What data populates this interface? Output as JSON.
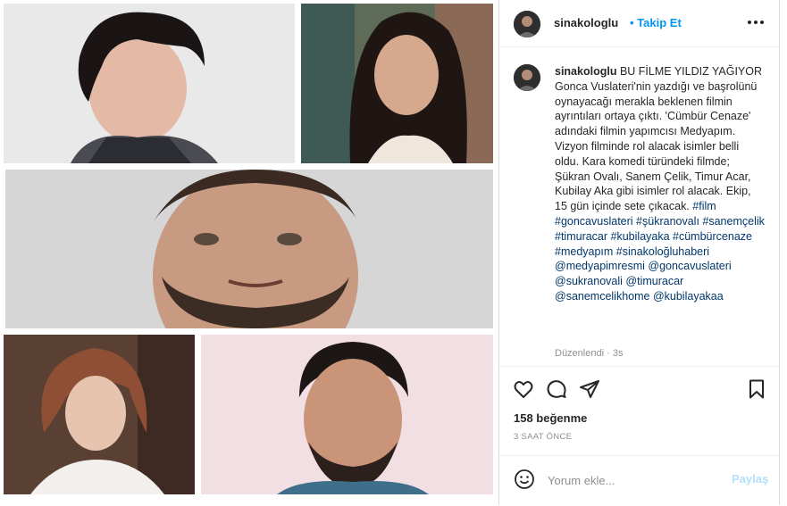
{
  "post": {
    "username": "sinakologlu",
    "follow_label": "Takip Et",
    "dot": "•",
    "caption_username": "sinakologlu",
    "caption_text": "BU FİLME YILDIZ YAĞIYOR Gonca Vuslateri'nin yazdığı ve başrolünü oynayacağı merakla beklenen filmin ayrıntıları ortaya çıktı. 'Cümbür Cenaze' adındaki filmin yapımcısı Medyapım. Vizyon filminde rol alacak isimler belli oldu. Kara komedi türündeki filmde; Şükran Ovalı, Sanem Çelik, Timur Acar, Kubilay Aka gibi isimler rol alacak. Ekip, 15 gün içinde sete çıkacak.",
    "tags": [
      "#film",
      "#goncavuslateri",
      "#şükranovalı",
      "#sanemçelik",
      "#timuracar",
      "#kubilayaka",
      "#cümbürcenaze",
      "#medyapım",
      "#sinakoloğluhaberi",
      "@medyapimresmi",
      "@goncavuslateri",
      "@sukranovali",
      "@timuracar",
      "@sanemcelikhome",
      "@kubilayakaa"
    ],
    "edited_label": "Düzenlendi",
    "edited_sep": "·",
    "edited_time": "3s",
    "likes": "158 beğenme",
    "time_ago": "3 SAAT ÖNCE",
    "comment_placeholder": "Yorum ekle...",
    "share_label": "Paylaş"
  },
  "icons": [
    "more-horizontal-icon",
    "heart-icon",
    "comment-icon",
    "share-icon",
    "bookmark-icon",
    "emoji-icon"
  ],
  "colors": {
    "link_blue": "#0095f6",
    "tag_blue": "#00376b",
    "share_disabled": "#b2dffc",
    "meta_gray": "#8e8e8e"
  }
}
